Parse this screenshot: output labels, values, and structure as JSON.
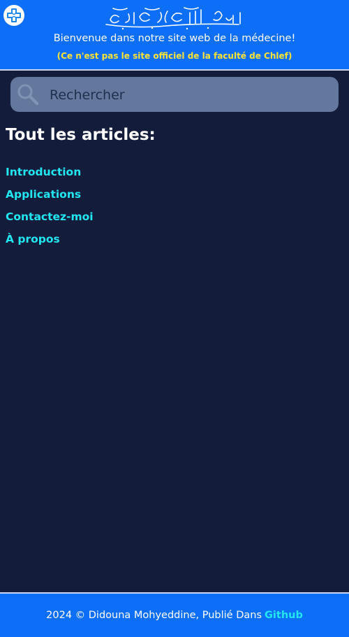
{
  "header": {
    "logo_icon": "medical-cross-icon",
    "basmala_icon": "basmala-calligraphy",
    "welcome_text": "Bienvenue dans notre site web de la médecine!",
    "disclaimer_text": "(Ce n'est pas le site officiel de la faculté de Chlef)",
    "background_color": "#0d6ef7",
    "disclaimer_color": "#ffe433"
  },
  "search": {
    "placeholder": "Rechercher",
    "value": "",
    "icon": "search-icon"
  },
  "main": {
    "title": "Tout les articles:",
    "articles": [
      {
        "label": "Introduction"
      },
      {
        "label": "Applications"
      },
      {
        "label": "Contactez-moi"
      },
      {
        "label": "À propos"
      }
    ],
    "link_color": "#22e6f0",
    "background_color": "#131d3b"
  },
  "footer": {
    "text": "2024 © Didouna Mohyeddine, Publié Dans",
    "link_label": "Github"
  }
}
